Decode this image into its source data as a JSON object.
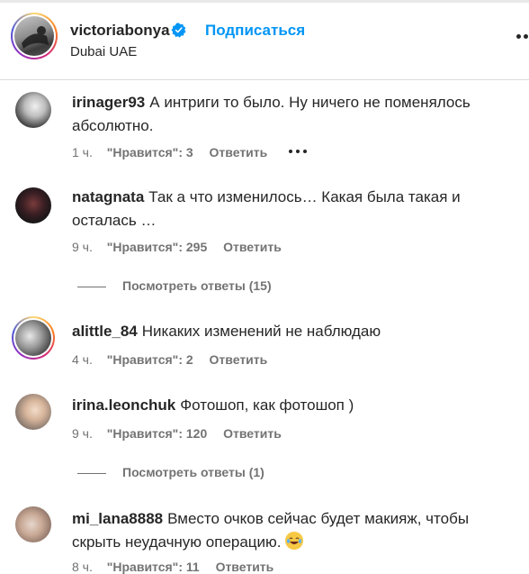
{
  "post_header": {
    "username": "victoriabonya",
    "follow_label": "Подписаться",
    "location": "Dubai UAE"
  },
  "comments": [
    {
      "username": "irinager93",
      "text": "А интриги то было. Ну ничего не поменялось абсолютно.",
      "time": "1 ч.",
      "likes": "\"Нравится\": 3",
      "reply": "Ответить"
    },
    {
      "username": "natagnata",
      "text": "Так а что изменилось… Какая была такая и осталась …",
      "time": "9 ч.",
      "likes": "\"Нравится\": 295",
      "reply": "Ответить",
      "view_replies": "Посмотреть ответы (15)"
    },
    {
      "username": "alittle_84",
      "text": "Никаких изменений не наблюдаю",
      "time": "4 ч.",
      "likes": "\"Нравится\": 2",
      "reply": "Ответить"
    },
    {
      "username": "irina.leonchuk",
      "text": "Фотошоп, как фотошоп )",
      "time": "9 ч.",
      "likes": "\"Нравится\": 120",
      "reply": "Ответить",
      "view_replies": "Посмотреть ответы (1)"
    },
    {
      "username": "mi_lana8888",
      "text": "Вместо очков сейчас будет макияж, чтобы скрыть неудачную операцию.",
      "time": "8 ч.",
      "likes": "\"Нравится\": 11",
      "reply": "Ответить"
    }
  ],
  "icons": {
    "verified": "verified-badge-icon",
    "more": "more-horizontal-icon",
    "emoji": "laughing-crying-emoji"
  },
  "colors": {
    "accent": "#0095f6",
    "text": "#262626",
    "secondary": "#737373",
    "verified": "#0095f6"
  }
}
